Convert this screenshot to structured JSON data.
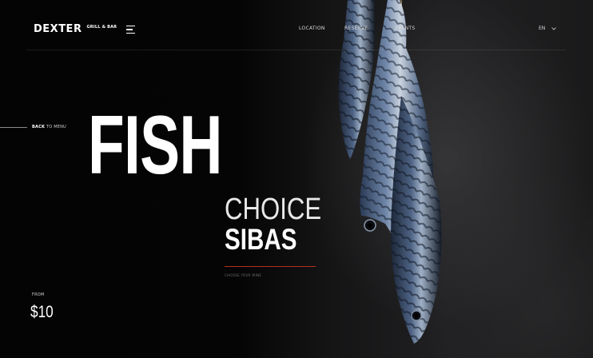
{
  "brand": {
    "logo": "DEXTER",
    "subtitle": "GRILL & BAR"
  },
  "nav": {
    "items": [
      "LOCATION",
      "RESERVE",
      "EVENTS"
    ]
  },
  "language": {
    "current": "EN"
  },
  "back_link": {
    "bold": "BACK",
    "rest": "TO MENU"
  },
  "hero": {
    "category": "FISH",
    "line1": "CHOICE",
    "line2": "SIBAS",
    "hint": "CHOOSE YOUR WINE"
  },
  "price": {
    "label": "FROM",
    "value": "$10"
  },
  "colors": {
    "accent": "#b0301f",
    "background": "#050505",
    "text": "#ffffff"
  }
}
